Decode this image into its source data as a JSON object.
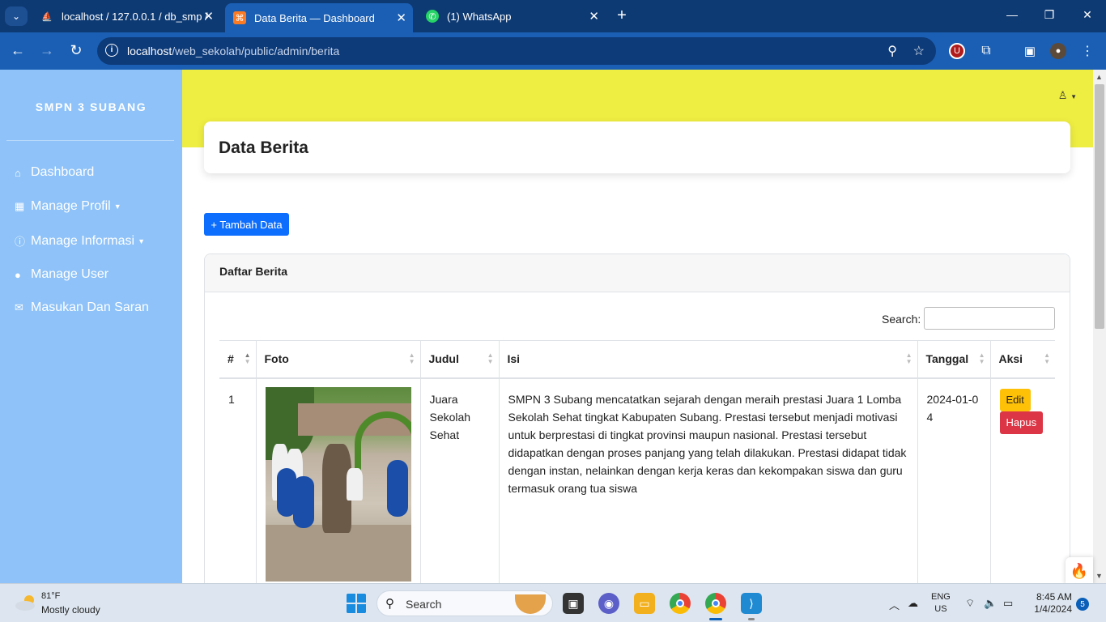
{
  "browser": {
    "tabs": [
      {
        "title": "localhost / 127.0.0.1 / db_smp /",
        "active": false
      },
      {
        "title": "Data Berita — Dashboard",
        "active": true
      },
      {
        "title": "(1) WhatsApp",
        "active": false
      }
    ],
    "url_host": "localhost",
    "url_path": "/web_sekolah/public/admin/berita"
  },
  "sidebar": {
    "brand": "SMPN 3 SUBANG",
    "items": [
      {
        "label": "Dashboard",
        "icon": "home-icon"
      },
      {
        "label": "Manage Profil",
        "icon": "table-icon",
        "dropdown": true
      },
      {
        "label": "Manage Informasi",
        "icon": "info-icon",
        "dropdown": true
      },
      {
        "label": "Manage User",
        "icon": "user-icon"
      },
      {
        "label": "Masukan Dan Saran",
        "icon": "mail-icon"
      }
    ]
  },
  "page": {
    "title": "Data Berita",
    "add_button": "+ Tambah Data",
    "card_title": "Daftar Berita",
    "search_label": "Search:",
    "search_value": "",
    "columns": [
      "#",
      "Foto",
      "Judul",
      "Isi",
      "Tanggal",
      "Aksi"
    ],
    "rows": [
      {
        "no": "1",
        "judul": "Juara Sekolah Sehat",
        "isi": "SMPN 3 Subang mencatatkan sejarah dengan meraih prestasi Juara 1 Lomba Sekolah Sehat tingkat Kabupaten Subang. Prestasi tersebut menjadi motivasi untuk berprestasi di tingkat provinsi maupun nasional. Prestasi tersebut didapatkan dengan proses panjang yang telah dilakukan. Prestasi didapat tidak dengan instan, nelainkan dengan kerja keras dan kekompakan siswa dan guru termasuk orang tua siswa",
        "tanggal": "2024-01-04",
        "edit_label": "Edit",
        "delete_label": "Hapus"
      }
    ]
  },
  "taskbar": {
    "weather_temp": "81°F",
    "weather_desc": "Mostly cloudy",
    "search_label": "Search",
    "lang_1": "ENG",
    "lang_2": "US",
    "time": "8:45 AM",
    "date": "1/4/2024",
    "notifications": "5"
  },
  "colors": {
    "sidebar": "#8ec2f8",
    "topband": "#eeed42",
    "primary": "#0d6efd",
    "warning": "#ffc107",
    "danger": "#dc3545"
  }
}
